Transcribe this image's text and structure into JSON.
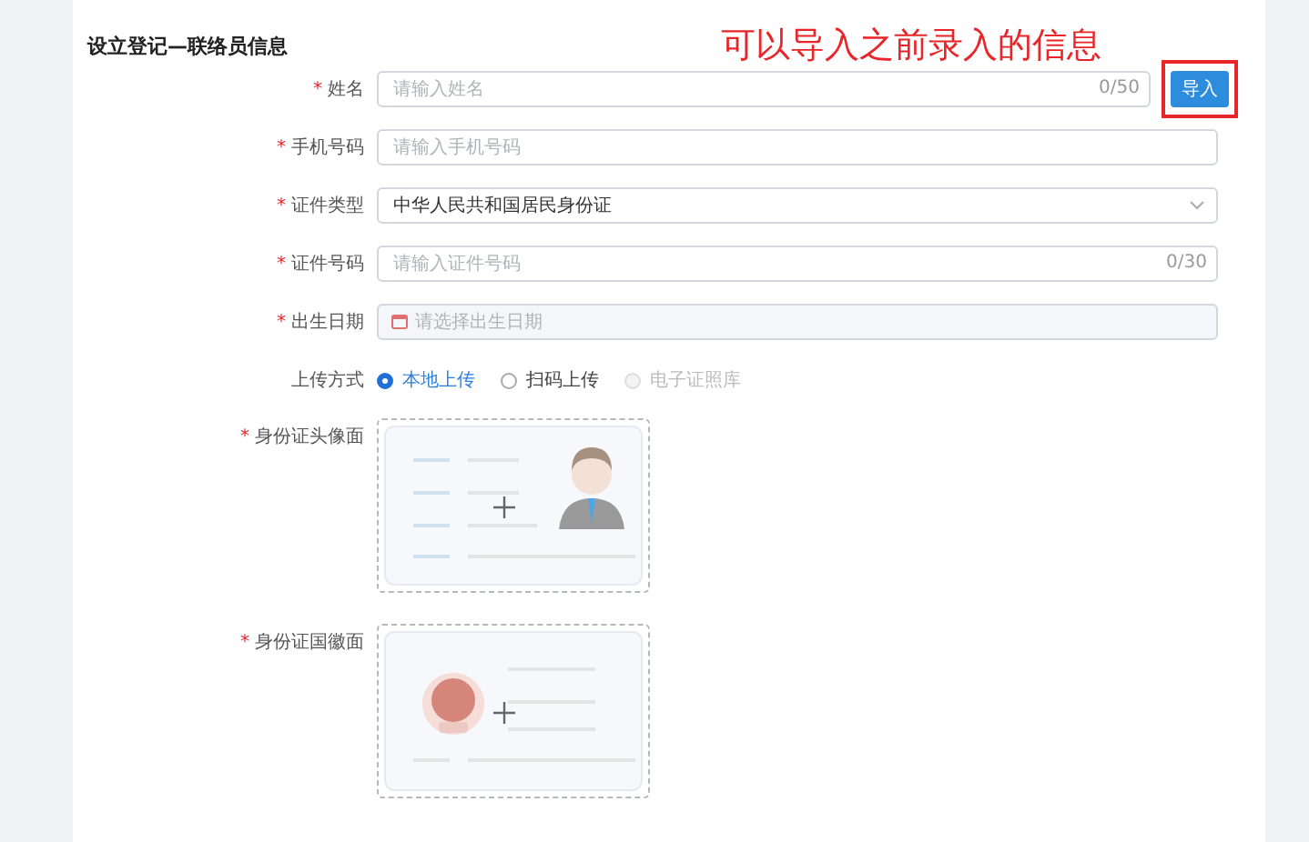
{
  "title": "设立登记—联络员信息",
  "annotation": "可以导入之前录入的信息",
  "fields": [
    {
      "kind": "input",
      "label": "姓名",
      "required": "*",
      "placeholder": "请输入姓名",
      "counter": "0/50",
      "button": "导入"
    },
    {
      "kind": "input",
      "label": "手机号码",
      "required": "*",
      "placeholder": "请输入手机号码"
    },
    {
      "kind": "select",
      "label": "证件类型",
      "required": "*",
      "value": "中华人民共和国居民身份证"
    },
    {
      "kind": "input",
      "label": "证件号码",
      "required": "*",
      "placeholder": "请输入证件号码",
      "counter": "0/30"
    },
    {
      "kind": "date",
      "label": "出生日期",
      "required": "*",
      "placeholder": "请选择出生日期"
    }
  ],
  "upload_method": {
    "label": "上传方式",
    "options": [
      {
        "label": "本地上传",
        "selected": true,
        "disabled": false
      },
      {
        "label": "扫码上传",
        "selected": false,
        "disabled": false
      },
      {
        "label": "电子证照库",
        "selected": false,
        "disabled": true
      }
    ]
  },
  "uploads": [
    {
      "kind": "portrait",
      "label": "身份证头像面",
      "required": "*"
    },
    {
      "kind": "emblem",
      "label": "身份证国徽面",
      "required": "*"
    }
  ]
}
